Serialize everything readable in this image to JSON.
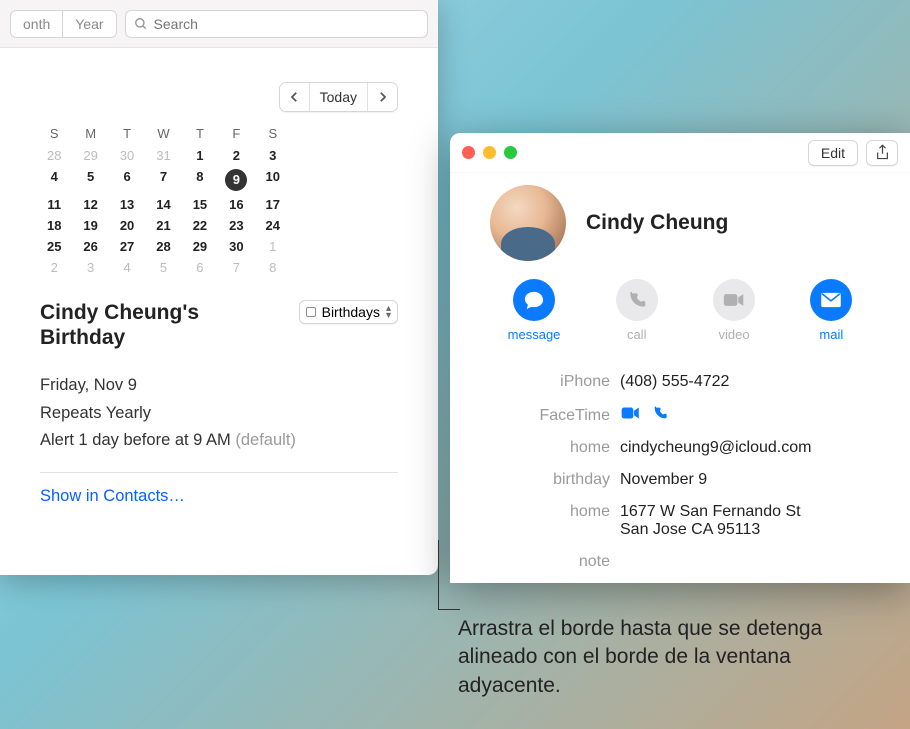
{
  "calendar": {
    "tabs": {
      "month": "onth",
      "year": "Year"
    },
    "search_placeholder": "Search",
    "today_label": "Today",
    "days_of_week": [
      "S",
      "M",
      "T",
      "W",
      "T",
      "F",
      "S"
    ],
    "grid": [
      {
        "n": "28",
        "o": true
      },
      {
        "n": "29",
        "o": true
      },
      {
        "n": "30",
        "o": true
      },
      {
        "n": "31",
        "o": true
      },
      {
        "n": "1"
      },
      {
        "n": "2"
      },
      {
        "n": "3"
      },
      {
        "n": "4"
      },
      {
        "n": "5"
      },
      {
        "n": "6"
      },
      {
        "n": "7"
      },
      {
        "n": "8"
      },
      {
        "n": "9",
        "sel": true
      },
      {
        "n": "10"
      },
      {
        "n": "11"
      },
      {
        "n": "12"
      },
      {
        "n": "13"
      },
      {
        "n": "14"
      },
      {
        "n": "15"
      },
      {
        "n": "16"
      },
      {
        "n": "17"
      },
      {
        "n": "18"
      },
      {
        "n": "19"
      },
      {
        "n": "20"
      },
      {
        "n": "21"
      },
      {
        "n": "22"
      },
      {
        "n": "23"
      },
      {
        "n": "24"
      },
      {
        "n": "25"
      },
      {
        "n": "26"
      },
      {
        "n": "27"
      },
      {
        "n": "28"
      },
      {
        "n": "29"
      },
      {
        "n": "30"
      },
      {
        "n": "1",
        "o": true
      },
      {
        "n": "2",
        "o": true
      },
      {
        "n": "3",
        "o": true
      },
      {
        "n": "4",
        "o": true
      },
      {
        "n": "5",
        "o": true
      },
      {
        "n": "6",
        "o": true
      },
      {
        "n": "7",
        "o": true
      },
      {
        "n": "8",
        "o": true
      }
    ],
    "event": {
      "title": "Cindy Cheung's Birthday",
      "calendar_name": "Birthdays",
      "date": "Friday, Nov 9",
      "repeat": "Repeats Yearly",
      "alert": "Alert 1 day before at 9 AM",
      "alert_default": "(default)",
      "link": "Show in Contacts…"
    }
  },
  "contact": {
    "edit_label": "Edit",
    "name": "Cindy Cheung",
    "actions": {
      "message": "message",
      "call": "call",
      "video": "video",
      "mail": "mail"
    },
    "fields": {
      "phone_label": "iPhone",
      "phone_value": "(408) 555-4722",
      "facetime_label": "FaceTime",
      "email_label": "home",
      "email_value": "cindycheung9@icloud.com",
      "birthday_label": "birthday",
      "birthday_value": "November 9",
      "address_label": "home",
      "address_value_l1": "1677 W San Fernando St",
      "address_value_l2": "San Jose CA 95113",
      "note_label": "note"
    }
  },
  "callout": "Arrastra el borde hasta que se detenga alineado con el borde de la ventana adyacente."
}
